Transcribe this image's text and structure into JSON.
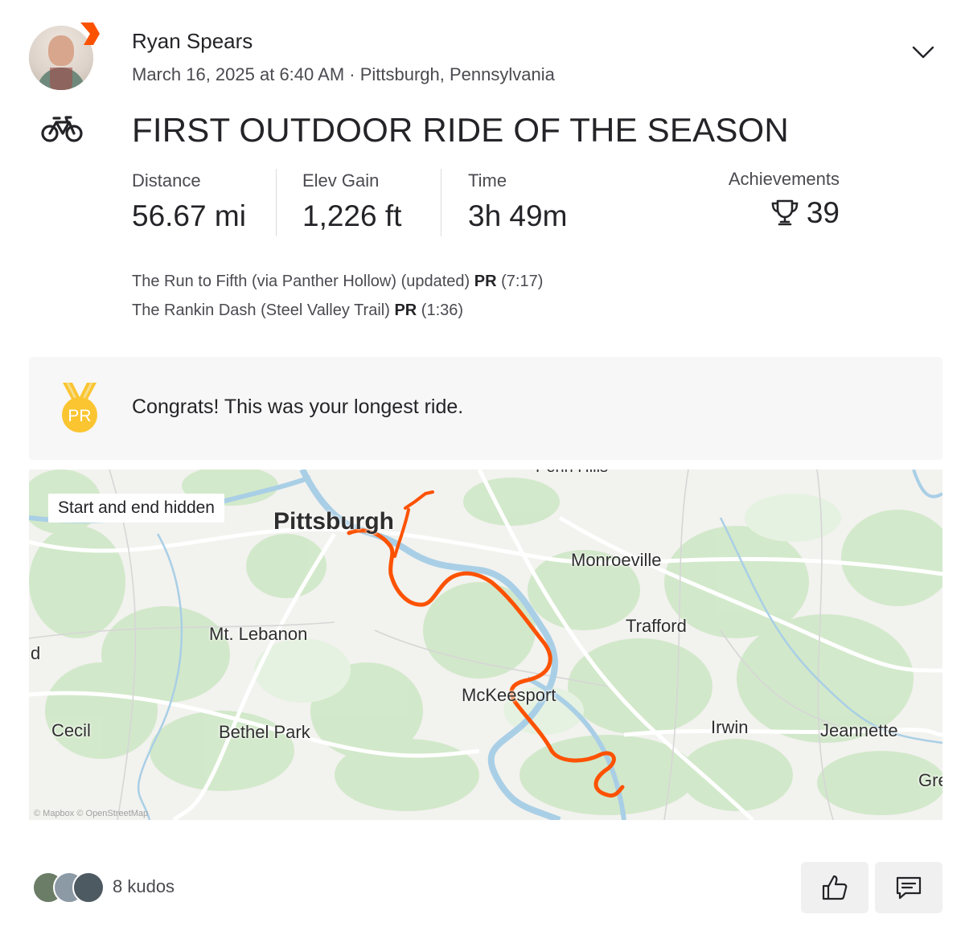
{
  "header": {
    "user_name": "Ryan Spears",
    "post_meta": "March 16, 2025 at 6:40 AM · Pittsburgh, Pennsylvania",
    "menu_icon": "chevron-down-icon",
    "avatar_icon": "user-avatar",
    "subscriber_badge_color": "#fc5200"
  },
  "activity": {
    "type_icon": "bike-icon",
    "title": "FIRST OUTDOOR RIDE OF THE SEASON",
    "stats": [
      {
        "label": "Distance",
        "value": "56.67 mi"
      },
      {
        "label": "Elev Gain",
        "value": "1,226 ft"
      },
      {
        "label": "Time",
        "value": "3h 49m"
      }
    ],
    "achievements": {
      "label": "Achievements",
      "count": "39",
      "icon": "trophy-icon"
    }
  },
  "segments": [
    {
      "name": "The Run to Fifth (via Panther Hollow) (updated)",
      "badge": "PR",
      "time": "(7:17)"
    },
    {
      "name": "The Rankin Dash (Steel Valley Trail)",
      "badge": "PR",
      "time": "(1:36)"
    }
  ],
  "banner": {
    "text": "Congrats! This was your longest ride.",
    "medal_label": "PR",
    "medal_color": "#fbc531"
  },
  "map": {
    "privacy_label": "Start and end hidden",
    "attribution": "© Mapbox © OpenStreetMap",
    "route_color": "#fc5200",
    "places": {
      "penn_hills": "Penn Hills",
      "pittsburgh": "Pittsburgh",
      "monroeville": "Monroeville",
      "trafford": "Trafford",
      "mt_lebanon": "Mt. Lebanon",
      "mckeesport": "McKeesport",
      "cecil": "Cecil",
      "bethel_park": "Bethel Park",
      "irwin": "Irwin",
      "jeannette": "Jeannette",
      "greensburg_partial": "Gre",
      "edge_partial": "d"
    }
  },
  "footer": {
    "kudos_text": "8 kudos",
    "like_icon": "thumbs-up-icon",
    "comment_icon": "comment-icon"
  }
}
